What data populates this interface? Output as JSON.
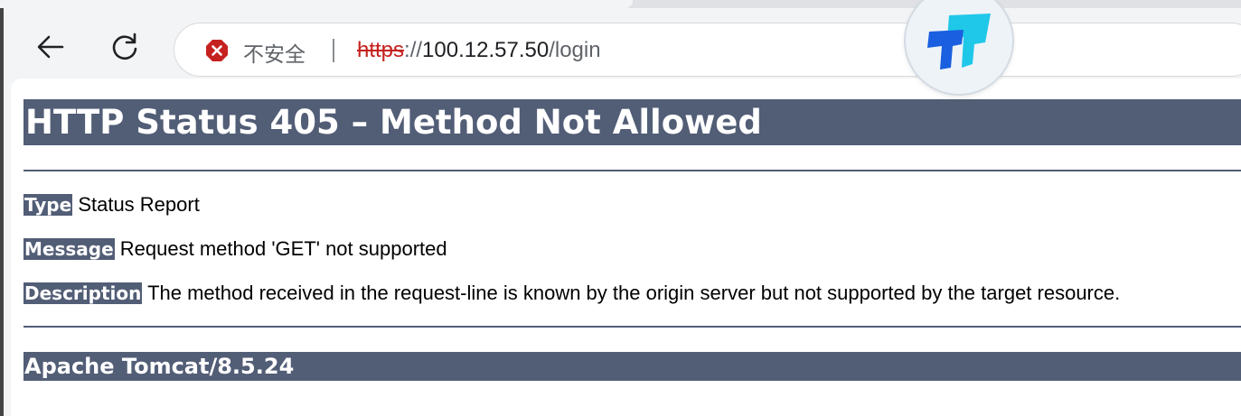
{
  "browser": {
    "security_label": "不安全",
    "url_scheme": "https",
    "url_separator": "://",
    "url_host": "100.12.57.50",
    "url_path": "/login",
    "icons": {
      "back": "arrow-left-icon",
      "reload": "reload-icon",
      "security": "not-secure-warning-icon",
      "extension": "extension-logo-icon"
    },
    "colors": {
      "warning": "#c5221f",
      "extension_light": "#1fc8e8",
      "extension_dark": "#1a5fe0"
    }
  },
  "page": {
    "title": "HTTP Status 405 – Method Not Allowed",
    "type_label": "Type",
    "type_value": "Status Report",
    "message_label": "Message",
    "message_value": "Request method 'GET' not supported",
    "description_label": "Description",
    "description_value": "The method received in the request-line is known by the origin server but not supported by the target resource.",
    "server_info": "Apache Tomcat/8.5.24",
    "colors": {
      "header_bg": "#525d76",
      "header_text": "#ffffff"
    }
  }
}
